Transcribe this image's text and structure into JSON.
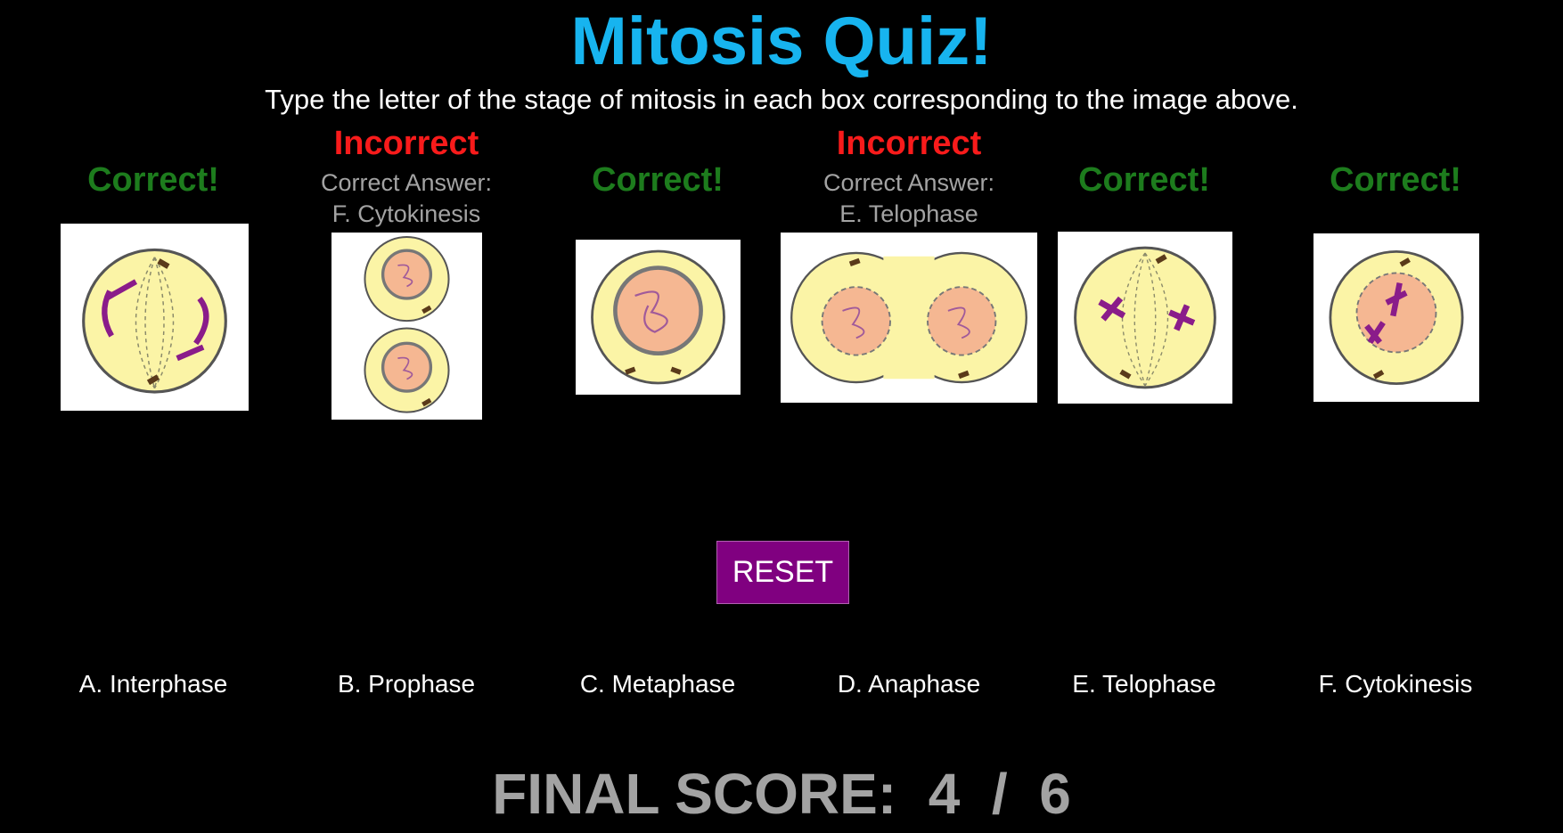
{
  "title": "Mitosis Quiz!",
  "instructions": "Type the letter of the stage of mitosis in each box corresponding to the image above.",
  "questions": [
    {
      "status": "Correct!",
      "result": "correct",
      "icon": "interphase-cell-icon"
    },
    {
      "status": "Incorrect",
      "result": "incorrect",
      "answer_label": "Correct Answer:",
      "answer_value": "F. Cytokinesis",
      "icon": "cytokinesis-cells-icon"
    },
    {
      "status": "Correct!",
      "result": "correct",
      "icon": "prophase-cell-icon"
    },
    {
      "status": "Incorrect",
      "result": "incorrect",
      "answer_label": "Correct Answer:",
      "answer_value": "E. Telophase",
      "icon": "telophase-cell-icon"
    },
    {
      "status": "Correct!",
      "result": "correct",
      "icon": "anaphase-cell-icon"
    },
    {
      "status": "Correct!",
      "result": "correct",
      "icon": "metaphase-cell-icon"
    }
  ],
  "reset_label": "RESET",
  "options": [
    "A. Interphase",
    "B. Prophase",
    "C. Metaphase",
    "D. Anaphase",
    "E. Telophase",
    "F. Cytokinesis"
  ],
  "score": {
    "label": "FINAL SCORE:",
    "value": "4",
    "separator": "/",
    "total": "6"
  },
  "colors": {
    "title": "#17b4ef",
    "correct": "#1d7c1d",
    "incorrect": "#f81b1b",
    "reset_button": "#800080",
    "muted_text": "#a3a3a3",
    "cell_cytoplasm": "#fbf4a6",
    "cell_nucleus": "#f5b792",
    "chromosome": "#8a1c8a"
  }
}
